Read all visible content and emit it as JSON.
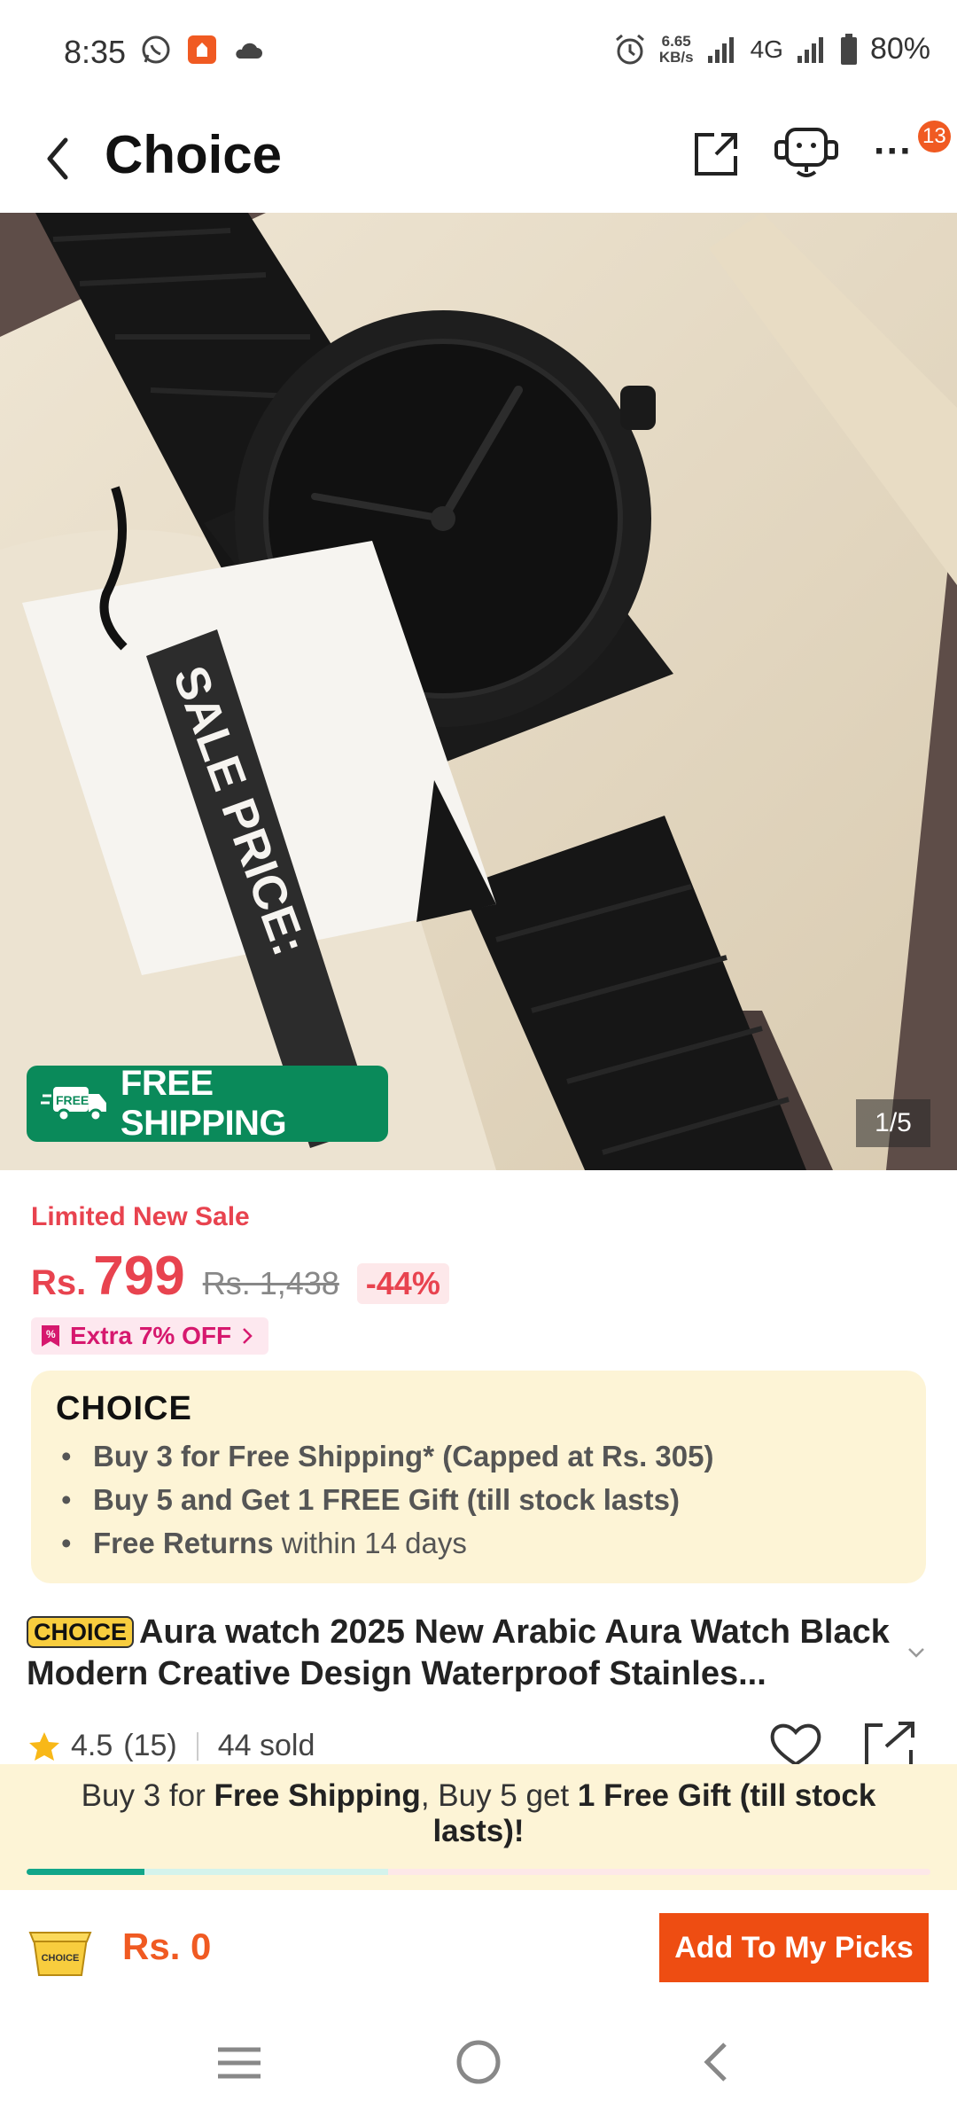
{
  "status_bar": {
    "time": "8:35",
    "network_speed_value": "6.65",
    "network_speed_unit": "KB/s",
    "network_type": "4G",
    "battery": "80%"
  },
  "header": {
    "title": "Choice",
    "notification_count": "13",
    "icons": [
      "back-icon",
      "share-icon",
      "support-icon",
      "more-icon"
    ]
  },
  "gallery": {
    "counter": "1/5",
    "free_shipping_badge": "FREE SHIPPING",
    "free_shipping_truck_label": "FREE",
    "image_text": "SALE PRICE:"
  },
  "price": {
    "promo_label": "Limited New Sale",
    "currency": "Rs.",
    "current": "799",
    "original": "Rs. 1,438",
    "discount": "-44%",
    "coupon": "Extra 7% OFF"
  },
  "choice_box": {
    "logo": "CHOICE",
    "items": [
      {
        "bold": "Buy 3 for  Free Shipping* (Capped at Rs. 305)",
        "rest": ""
      },
      {
        "bold": "Buy 5 and Get 1 FREE Gift (till stock lasts)",
        "rest": ""
      },
      {
        "bold": "Free Returns",
        "rest": " within 14 days"
      }
    ]
  },
  "product": {
    "tag": "CHOICE",
    "title": "Aura watch 2025 New Arabic Aura Watch Black Modern Creative Design Waterproof Stainles...",
    "rating": "4.5",
    "reviews": "(15)",
    "sold": "44 sold"
  },
  "bundle_banner": {
    "part1": "Buy 3 for ",
    "part2": "Free Shipping",
    "part3": ", Buy 5 get ",
    "part4": "1 Free Gift (till stock lasts)!",
    "progress": 0.13
  },
  "bottom_bar": {
    "cart_label": "CHOICE",
    "total": "Rs. 0",
    "add_button": "Add To My Picks"
  },
  "colors": {
    "accent": "#ee4d12",
    "price_red": "#e8434f",
    "free_shipping_green": "#0a8a5a",
    "choice_bg": "#fdf4d6",
    "choice_yellow": "#f8cd3e"
  }
}
